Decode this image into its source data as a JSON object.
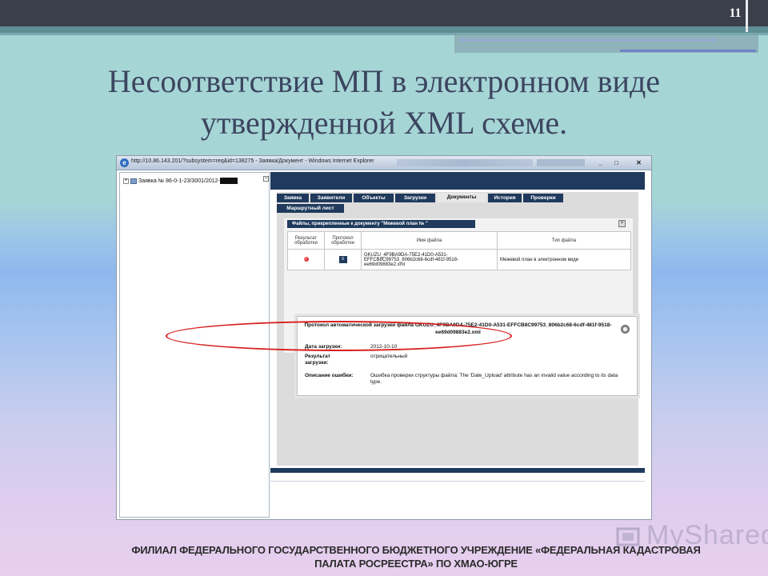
{
  "slide": {
    "number": "11",
    "title_line1": "Несоответствие МП в электронном виде",
    "title_line2": "утвержденной XML схеме.",
    "footer_line1": "ФИЛИАЛ ФЕДЕРАЛЬНОГО ГОСУДАРСТВЕННОГО БЮДЖЕТНОГО УЧРЕЖДЕНИЕ «ФЕДЕРАЛЬНАЯ КАДАСТРОВАЯ",
    "footer_line2": "ПАЛАТА РОСРЕЕСТРА» ПО ХМАО-ЮГРЕ",
    "watermark": "MyShared"
  },
  "browser": {
    "title": "http://10.86.143.201/?subsystem=req&id=138275 - Заявка/Документ - Windows Internet Explorer",
    "btn_minimize": "_",
    "btn_maximize": "□",
    "btn_close": "✕"
  },
  "tree": {
    "expander": "+",
    "item_label": "Заявка № 86-0-1-23/3001/2012-",
    "collapse": "−"
  },
  "tabs": [
    {
      "label": "Заявка"
    },
    {
      "label": "Заявители"
    },
    {
      "label": "Объекты"
    },
    {
      "label": "Загрузки"
    },
    {
      "label": "Документы"
    },
    {
      "label": "История"
    },
    {
      "label": "Проверки"
    },
    {
      "label": "Маршрутный лист"
    }
  ],
  "files_panel": {
    "header": "Файлы, прикрепленные к документу \"Межевой план № \"",
    "close": "×",
    "columns": [
      "Результат обработки",
      "Протокол обработки",
      "Имя файла",
      "Тип файла"
    ],
    "row": {
      "protocol_icon": "≡",
      "file_name": "GKUZU_4F9BA9DA-75E2-41D0-A531-EFFCB8C99753_806b2c68-6cdf-481f-9518-ee69d09883e2.xml",
      "file_type": "Межевой план в электронном виде"
    }
  },
  "protocol_popup": {
    "title": "Протокол автоматической загрузки файла GKUZU_4F9BA9DA-75E2-41D0-A531-EFFCB8C99753_806b2c68-6cdf-481f-9518-ee69d09883e2.xml",
    "date_label": "Дата загрузки:",
    "date_value": "2012-10-10",
    "result_label": "Результат загрузки:",
    "result_value": "отрицательный",
    "error_label": "Описание ошибки:",
    "error_value": "Ошибка проверки структуры файла: The 'Date_Upload' attribute has an invalid value according to its data type."
  },
  "colors": {
    "slide_bg_top": "#a6d5d5",
    "header_dark": "#3b3f4a",
    "app_navy": "#1f3a5c",
    "highlight_red": "#d82020",
    "title_text": "#3c4560"
  }
}
